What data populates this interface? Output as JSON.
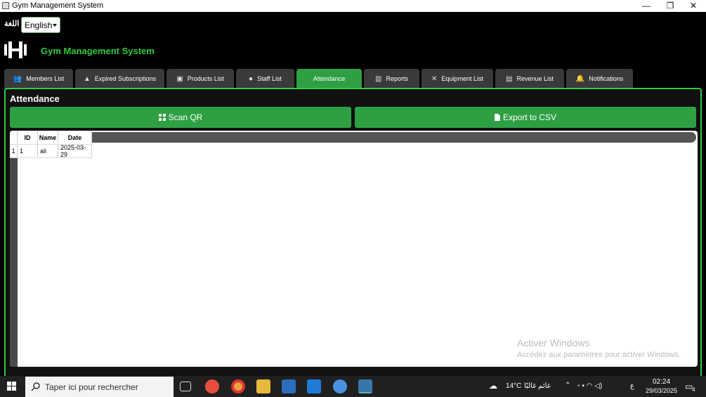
{
  "window": {
    "title": "Gym Management System",
    "minimize": "—",
    "restore": "❐",
    "close": "✕"
  },
  "header": {
    "lang_label": "اللغة",
    "lang_value": "English",
    "app_title": "Gym Management System"
  },
  "tabs": [
    {
      "label": "Members List",
      "icon": "users-icon",
      "glyph": "👥"
    },
    {
      "label": "Expired Subscriptions",
      "icon": "warning-icon",
      "glyph": "▲"
    },
    {
      "label": "Products List",
      "icon": "box-icon",
      "glyph": "▣"
    },
    {
      "label": "Staff List",
      "icon": "person-icon",
      "glyph": "●"
    },
    {
      "label": "Attendance",
      "icon": "",
      "glyph": ""
    },
    {
      "label": "Reports",
      "icon": "chart-icon",
      "glyph": "▥"
    },
    {
      "label": "Equipment List",
      "icon": "tools-icon",
      "glyph": "✕"
    },
    {
      "label": "Revenue List",
      "icon": "money-icon",
      "glyph": "▤"
    },
    {
      "label": "Notifications",
      "icon": "bell-icon",
      "glyph": "🔔"
    }
  ],
  "attendance": {
    "title": "Attendance",
    "scan_label": "Scan QR",
    "export_label": "Export to CSV",
    "columns": [
      "ID",
      "Name",
      "Date"
    ],
    "rows": [
      {
        "index": "1",
        "id": "1",
        "name": "ali",
        "date": "2025-03-29"
      }
    ]
  },
  "watermark": {
    "line1": "Activer Windows",
    "line2": "Accédez aux paramètres pour activer Windows."
  },
  "taskbar": {
    "search_placeholder": "Taper ici pour rechercher",
    "weather": "14°C",
    "weather_text": "غائم غالبًا",
    "lang": "ع",
    "time": "02:24",
    "date": "29/03/2025",
    "notif_count": "4"
  },
  "colors": {
    "accent": "#2ea043",
    "title_green": "#2ecc40",
    "tab_bg": "#3a3a3a"
  }
}
